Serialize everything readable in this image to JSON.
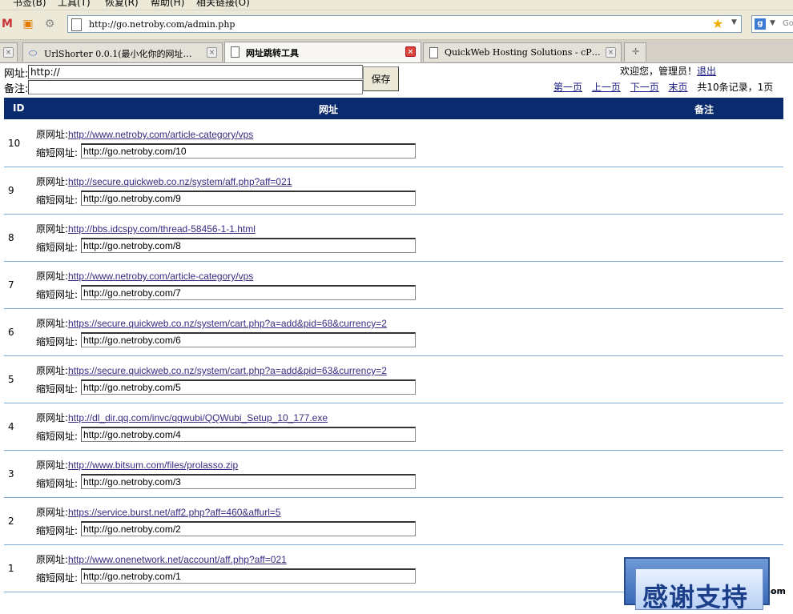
{
  "menubar": {
    "items": [
      "书签(B)",
      "工具(T)",
      "恢复(R)",
      "帮助(H)",
      "相关链接(O)"
    ]
  },
  "navbar": {
    "url": "http://go.netroby.com/admin.php"
  },
  "tabs": [
    {
      "label": "UrlShorter 0.0.1(最小化你的网址…",
      "active": false
    },
    {
      "label": "网址跳转工具",
      "active": true
    },
    {
      "label": "QuickWeb Hosting Solutions - cP…",
      "active": false
    }
  ],
  "form": {
    "url_label": "网址:",
    "url_value": "http://",
    "note_label": "备注:",
    "note_value": "",
    "save_label": "保存"
  },
  "header_right": {
    "welcome": "欢迎您，管理员！",
    "logout": "退出",
    "first": "第一页",
    "prev": "上一页",
    "next": "下一页",
    "last": "末页",
    "summary": "共10条记录，1页"
  },
  "table": {
    "columns": [
      "ID",
      "网址",
      "备注"
    ],
    "orig_label": "原网址:",
    "short_label": "缩短网址:",
    "rows": [
      {
        "id": "10",
        "orig": "http://www.netroby.com/article-category/vps",
        "short": "http://go.netroby.com/10"
      },
      {
        "id": "9",
        "orig": "http://secure.quickweb.co.nz/system/aff.php?aff=021",
        "short": "http://go.netroby.com/9"
      },
      {
        "id": "8",
        "orig": "http://bbs.idcspy.com/thread-58456-1-1.html",
        "short": "http://go.netroby.com/8"
      },
      {
        "id": "7",
        "orig": "http://www.netroby.com/article-category/vps",
        "short": "http://go.netroby.com/7"
      },
      {
        "id": "6",
        "orig": "https://secure.quickweb.co.nz/system/cart.php?a=add&pid=68&currency=2",
        "short": "http://go.netroby.com/6"
      },
      {
        "id": "5",
        "orig": "https://secure.quickweb.co.nz/system/cart.php?a=add&pid=63&currency=2",
        "short": "http://go.netroby.com/5"
      },
      {
        "id": "4",
        "orig": "http://dl_dir.qq.com/invc/qqwubi/QQWubi_Setup_10_177.exe",
        "short": "http://go.netroby.com/4"
      },
      {
        "id": "3",
        "orig": "http://www.bitsum.com/files/prolasso.zip",
        "short": "http://go.netroby.com/3"
      },
      {
        "id": "2",
        "orig": "https://service.burst.net/aff2.php?aff=460&affurl=5",
        "short": "http://go.netroby.com/2"
      },
      {
        "id": "1",
        "orig": "http://www.onenetwork.net/account/aff.php?aff=021",
        "short": "http://go.netroby.com/1"
      }
    ]
  },
  "banner": {
    "text": "感谢支持",
    "suffix": "om"
  }
}
